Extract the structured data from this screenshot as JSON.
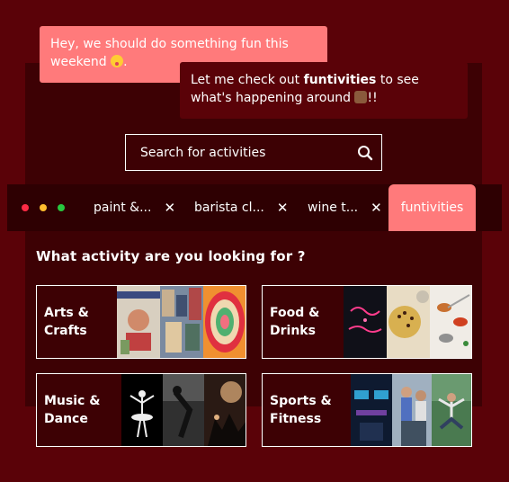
{
  "chat": {
    "message_1": "Hey, we should do something fun this weekend",
    "message_1_suffix": ".",
    "message_2_prefix": "Let me check out ",
    "message_2_highlight": "funtivities",
    "message_2_suffix": " to see what's happening around ",
    "message_2_end": "!!"
  },
  "search": {
    "placeholder": "Search for activities",
    "icon": "search-icon"
  },
  "window_controls": {
    "colors": [
      "#ff2b45",
      "#ffbd2e",
      "#28c840"
    ]
  },
  "tabs": [
    {
      "label": "paint &...",
      "close": "✕"
    },
    {
      "label": "barista cl...",
      "close": "✕"
    },
    {
      "label": "wine t...",
      "close": "✕"
    },
    {
      "label": "funtivities"
    }
  ],
  "section": {
    "title": "What activity are you looking for ?"
  },
  "categories": [
    {
      "label_line1": "Arts &",
      "label_line2": "Crafts"
    },
    {
      "label_line1": "Food &",
      "label_line2": "Drinks"
    },
    {
      "label_line1": "Music &",
      "label_line2": "Dance"
    },
    {
      "label_line1": "Sports &",
      "label_line2": "Fitness"
    }
  ],
  "colors": {
    "background": "#5a0208",
    "panel": "#3d0104",
    "accent": "#ff7a7b"
  }
}
